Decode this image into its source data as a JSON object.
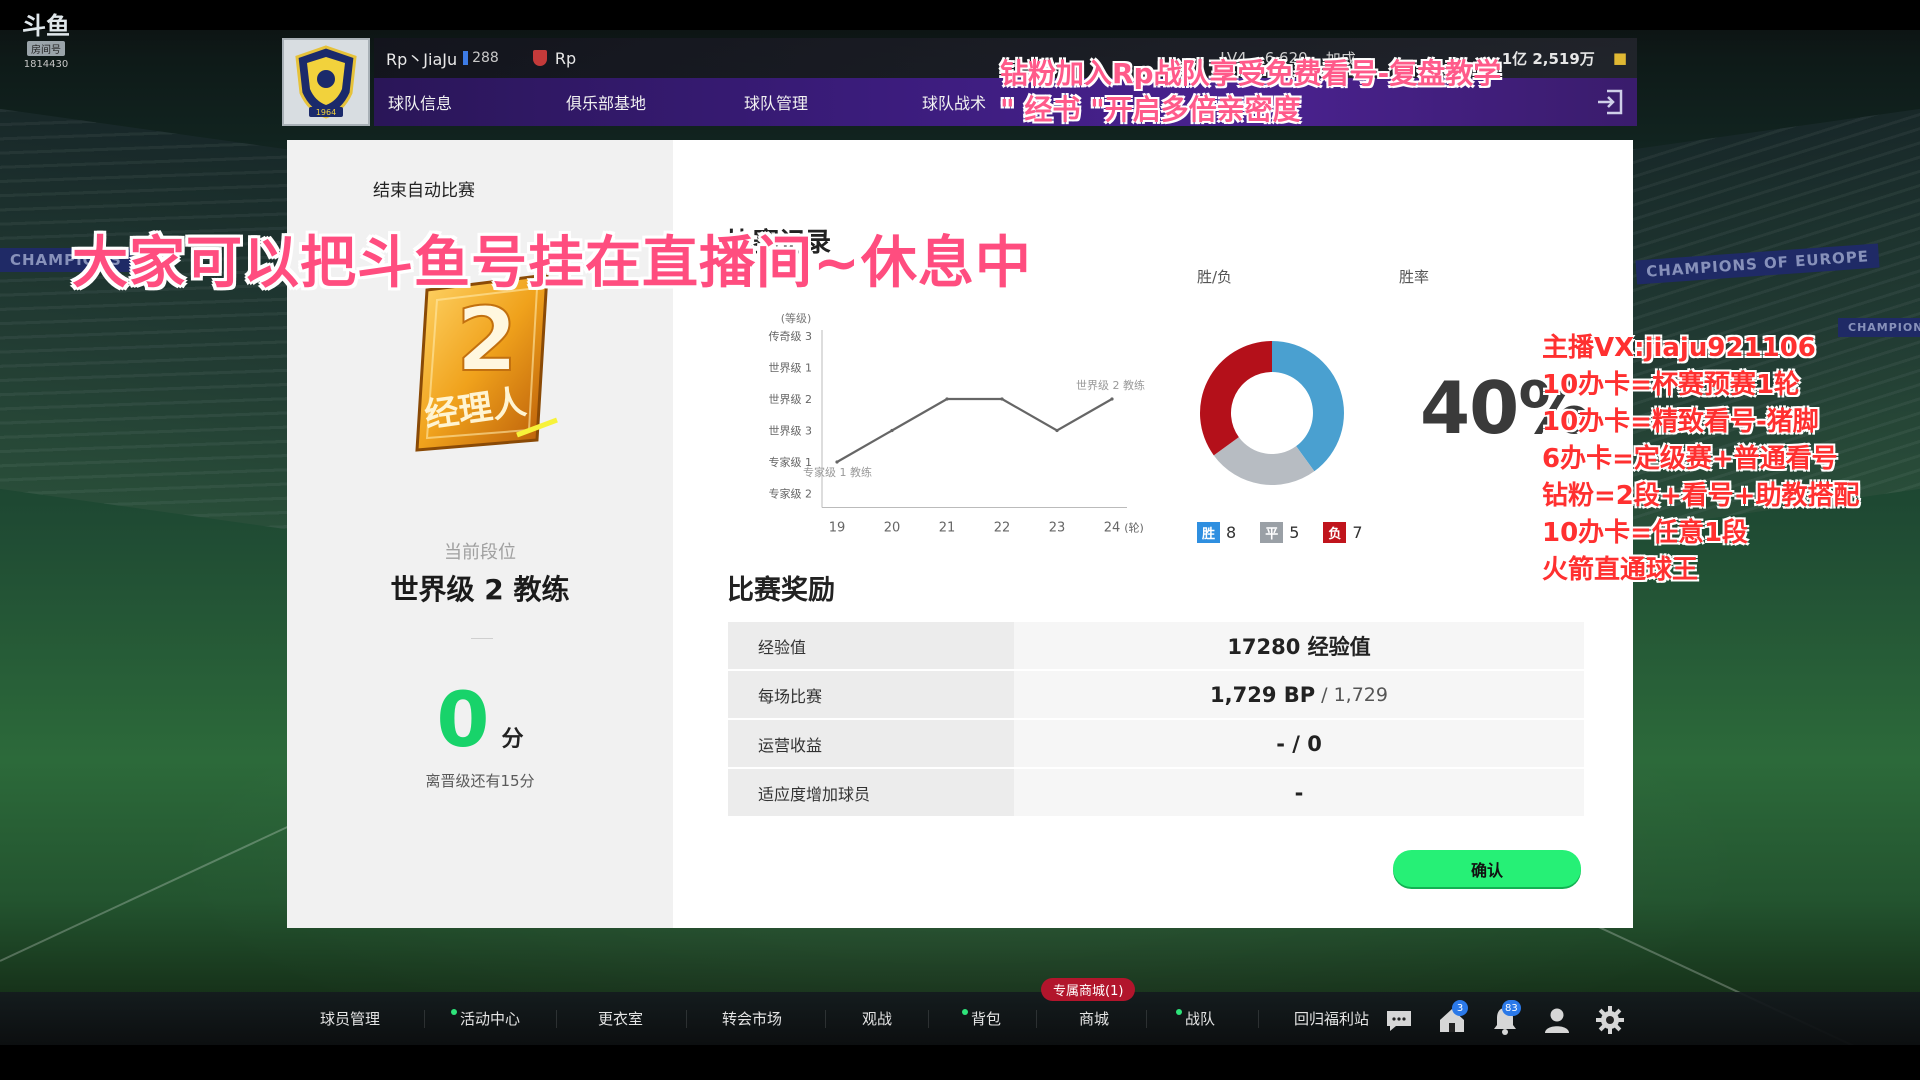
{
  "douyu": {
    "logo_text": "斗鱼",
    "tag": "房间号",
    "room_id": "1814430"
  },
  "header": {
    "team_label": "Rp丶JiaJu",
    "team_count": "288",
    "clan_name": "Rp",
    "level": "LV4",
    "stat": "6,620",
    "stat_suffix": "加成",
    "coins": "1亿 2,519万",
    "nav": [
      "球队信息",
      "俱乐部基地",
      "球队管理",
      "球队战术"
    ]
  },
  "dialog": {
    "end_auto_label": "结束自动比赛",
    "badge_number": "2",
    "badge_text": "经理人",
    "rank_label": "当前段位",
    "rank_name": "世界级 2 教练",
    "points": "0",
    "points_unit": "分",
    "promote_hint": "离晋级还有15分",
    "record_title": "比赛记录",
    "wl_label": "胜/负",
    "rate_label": "胜率",
    "win_rate": "40%",
    "legend": [
      {
        "tag": "胜",
        "value": "8",
        "color": "#2f8fe0"
      },
      {
        "tag": "平",
        "value": "5",
        "color": "#9aa0a6"
      },
      {
        "tag": "负",
        "value": "7",
        "color": "#c0141c"
      }
    ],
    "reward_title": "比赛奖励",
    "rewards": [
      {
        "key": "经验值",
        "value": "17280 经验值",
        "sub": ""
      },
      {
        "key": "每场比赛",
        "value": "1,729 BP",
        "sub": "/ 1,729"
      },
      {
        "key": "运营收益",
        "value": "- / 0",
        "sub": ""
      },
      {
        "key": "适应度增加球员",
        "value": "-",
        "sub": ""
      }
    ],
    "confirm_label": "确认"
  },
  "chart_data": {
    "type": "line",
    "title": "",
    "ylabel": "(等级)",
    "xlabel": "(轮)",
    "y_categories": [
      "传奇级 3",
      "世界级 1",
      "世界级 2",
      "世界级 3",
      "专家级 1",
      "专家级 2"
    ],
    "x": [
      19,
      20,
      21,
      22,
      23,
      24
    ],
    "series": [
      {
        "values": [
          "专家级 1",
          "世界级 3",
          "世界级 2",
          "世界级 2",
          "世界级 3",
          "世界级 2"
        ]
      }
    ],
    "annotations": [
      {
        "text": "专家级 1 教练",
        "at_x": 19
      },
      {
        "text": "世界级 2 教练",
        "at_x": 24
      }
    ]
  },
  "donut_data": {
    "type": "pie",
    "values": [
      8,
      5,
      7
    ],
    "labels": [
      "胜",
      "平",
      "负"
    ],
    "colors": [
      "#4aa0d0",
      "#b7bcc2",
      "#b4101a"
    ]
  },
  "overlays": {
    "promo_line1": "钻粉加入Rp战队享受免费看号-复盘教学",
    "promo_line2": "\" 经书 \"开启多倍亲密度",
    "rest_msg": "大家可以把斗鱼号挂在直播间~休息中",
    "services": [
      "主播VX:jiaju921106",
      "10办卡=杯赛预赛1轮",
      "10办卡=精致看号-猪脚",
      "6办卡=定级赛+普通看号",
      "钻粉=2段+看号+助教搭配",
      "10办卡=任意1段",
      "火箭直通球王"
    ]
  },
  "bottom_nav": {
    "items": [
      "球员管理",
      "活动中心",
      "更衣室",
      "转会市场",
      "观战",
      "背包",
      "商城",
      "战队",
      "回归福利站"
    ],
    "exclusive_shop": "专属商城(1)",
    "home_badge": "3",
    "bell_badge": "83"
  },
  "stadium_banners": [
    "CHAMPIONS",
    "CHAMPIONS OF EUROPE",
    "CHAMPIONS"
  ]
}
